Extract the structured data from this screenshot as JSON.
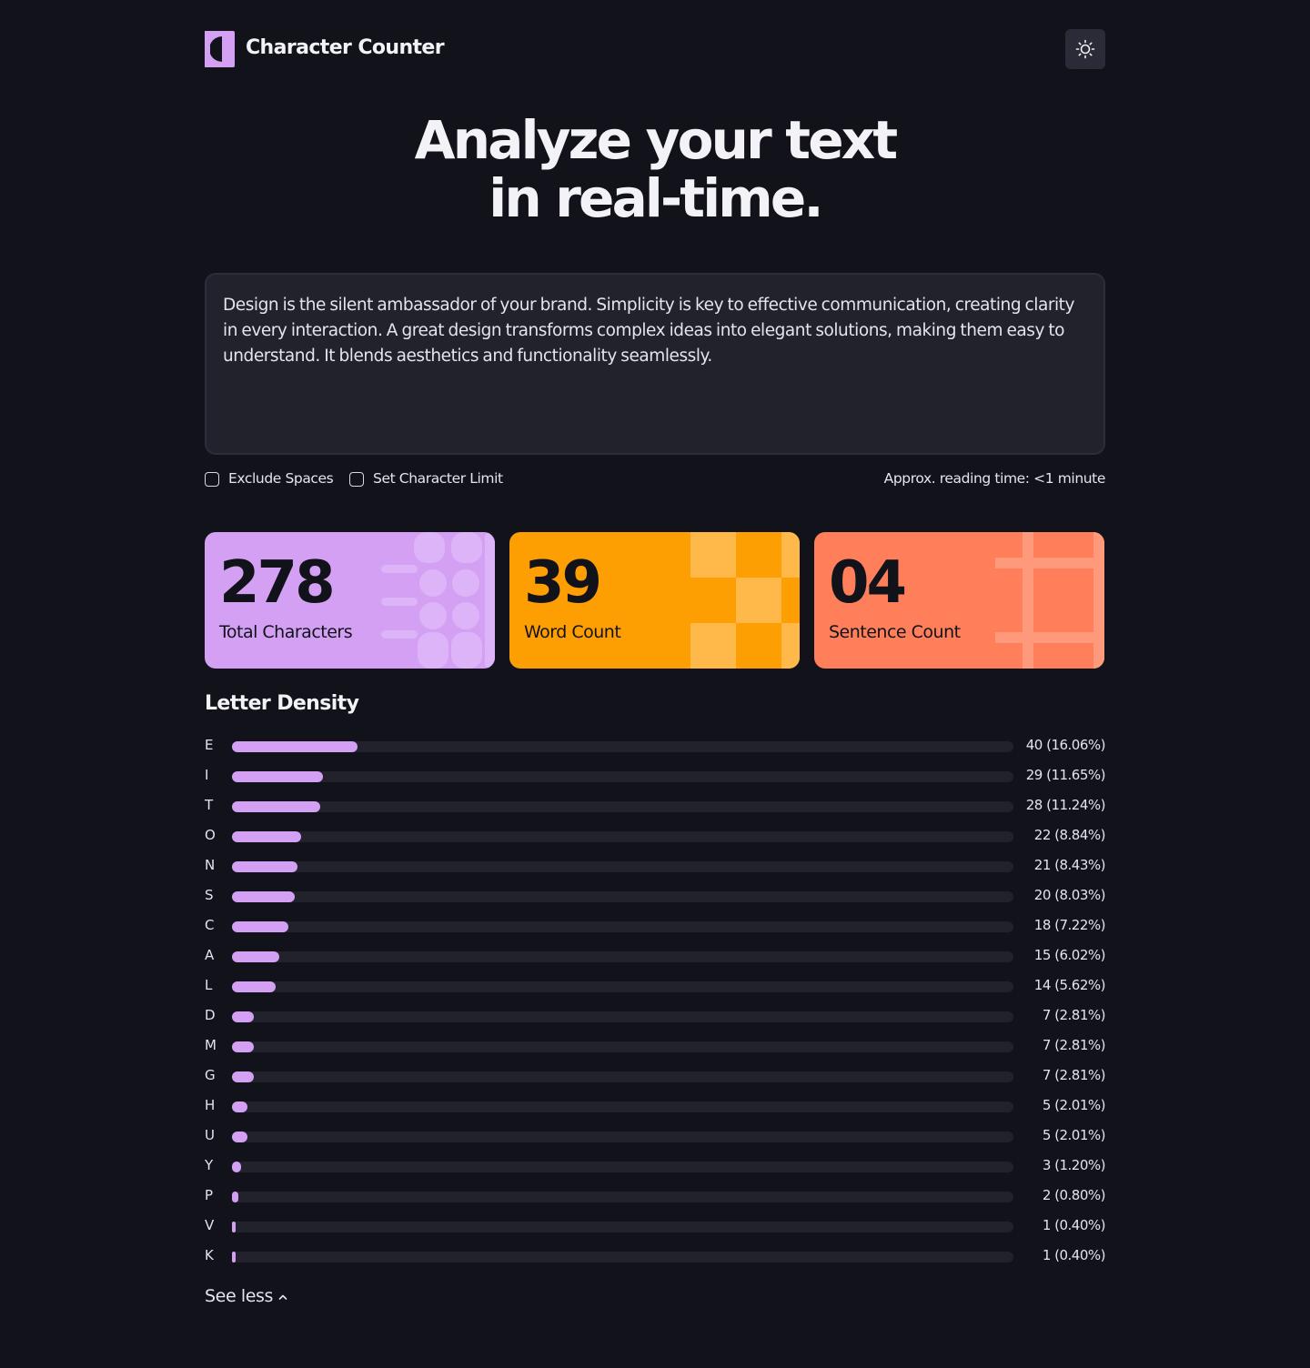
{
  "header": {
    "brand": "Character Counter",
    "theme_toggle_icon": "sun-icon"
  },
  "hero": {
    "line1": "Analyze your text",
    "line2": "in real-time."
  },
  "editor": {
    "text": "Design is the silent ambassador of your brand. Simplicity is key to effective communication, creating clarity in every interaction. A great design transforms complex ideas into elegant solutions, making them easy to understand. It blends aesthetics and functionality seamlessly."
  },
  "options": {
    "exclude_spaces": "Exclude Spaces",
    "exclude_spaces_checked": false,
    "set_limit": "Set Character Limit",
    "set_limit_checked": false,
    "reading_time": "Approx. reading time: <1 minute"
  },
  "stats": [
    {
      "value": "278",
      "label": "Total Characters",
      "color": "#d3a0f4"
    },
    {
      "value": "39",
      "label": "Word Count",
      "color": "#fd9e02"
    },
    {
      "value": "04",
      "label": "Sentence Count",
      "color": "#fe7f59"
    }
  ],
  "density": {
    "title": "Letter Density",
    "bar_color": "#d3a0f4",
    "rows": [
      {
        "letter": "E",
        "count": 40,
        "percent": 16.06,
        "display": "40 (16.06%)"
      },
      {
        "letter": "I",
        "count": 29,
        "percent": 11.65,
        "display": "29 (11.65%)"
      },
      {
        "letter": "T",
        "count": 28,
        "percent": 11.24,
        "display": "28 (11.24%)"
      },
      {
        "letter": "O",
        "count": 22,
        "percent": 8.84,
        "display": "22 (8.84%)"
      },
      {
        "letter": "N",
        "count": 21,
        "percent": 8.43,
        "display": "21 (8.43%)"
      },
      {
        "letter": "S",
        "count": 20,
        "percent": 8.03,
        "display": "20 (8.03%)"
      },
      {
        "letter": "C",
        "count": 18,
        "percent": 7.22,
        "display": "18 (7.22%)"
      },
      {
        "letter": "A",
        "count": 15,
        "percent": 6.02,
        "display": "15 (6.02%)"
      },
      {
        "letter": "L",
        "count": 14,
        "percent": 5.62,
        "display": "14 (5.62%)"
      },
      {
        "letter": "D",
        "count": 7,
        "percent": 2.81,
        "display": "7 (2.81%)"
      },
      {
        "letter": "M",
        "count": 7,
        "percent": 2.81,
        "display": "7 (2.81%)"
      },
      {
        "letter": "G",
        "count": 7,
        "percent": 2.81,
        "display": "7 (2.81%)"
      },
      {
        "letter": "H",
        "count": 5,
        "percent": 2.01,
        "display": "5 (2.01%)"
      },
      {
        "letter": "U",
        "count": 5,
        "percent": 2.01,
        "display": "5 (2.01%)"
      },
      {
        "letter": "Y",
        "count": 3,
        "percent": 1.2,
        "display": "3 (1.20%)"
      },
      {
        "letter": "P",
        "count": 2,
        "percent": 0.8,
        "display": "2 (0.80%)"
      },
      {
        "letter": "V",
        "count": 1,
        "percent": 0.4,
        "display": "1 (0.40%)"
      },
      {
        "letter": "K",
        "count": 1,
        "percent": 0.4,
        "display": "1 (0.40%)"
      }
    ],
    "toggle_label": "See less",
    "toggle_icon": "chevron-up-icon"
  }
}
